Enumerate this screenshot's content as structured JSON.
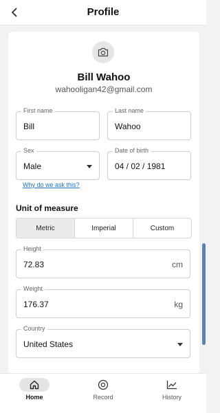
{
  "header": {
    "title": "Profile"
  },
  "profile": {
    "name": "Bill Wahoo",
    "email": "wahooligan42@gmail.com"
  },
  "fields": {
    "first_name": {
      "label": "First name",
      "value": "Bill"
    },
    "last_name": {
      "label": "Last name",
      "value": "Wahoo"
    },
    "sex": {
      "label": "Sex",
      "value": "Male"
    },
    "dob": {
      "label": "Date of birth",
      "value": "04 / 02 / 1981"
    },
    "height": {
      "label": "Height",
      "value": "72.83",
      "unit": "cm"
    },
    "weight": {
      "label": "Weight",
      "value": "176.37",
      "unit": "kg"
    },
    "country": {
      "label": "Country",
      "value": "United States"
    }
  },
  "why_link": "Why do we ask this?",
  "units": {
    "title": "Unit of measure",
    "options": [
      "Metric",
      "Imperial",
      "Custom"
    ],
    "selected": "Metric"
  },
  "nav": {
    "items": [
      {
        "label": "Home",
        "icon": "home-icon",
        "active": true
      },
      {
        "label": "Record",
        "icon": "record-icon",
        "active": false
      },
      {
        "label": "History",
        "icon": "history-icon",
        "active": false
      }
    ]
  },
  "colors": {
    "accent": "#1a73c9",
    "scrollbar": "#5b84ad",
    "background": "#f2f2f2"
  }
}
